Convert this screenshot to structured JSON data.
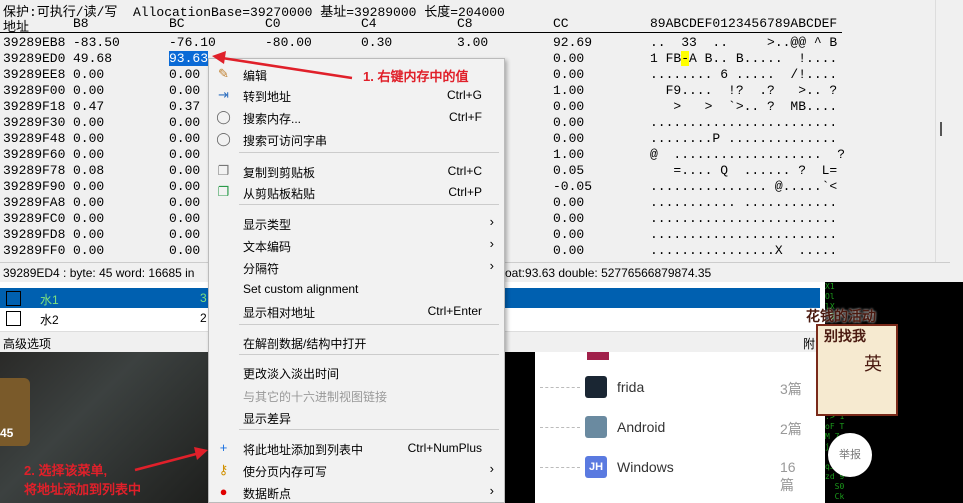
{
  "hexview": {
    "info": "保护:可执行/读/写  AllocationBase=39270000 基址=39289000 长度=204000",
    "headers": {
      "addr": "地址",
      "c1": "B8",
      "c2": "BC",
      "c3": "C0",
      "c4": "C4",
      "c5": "C8",
      "c6": "CC",
      "ascii": "89ABCDEF0123456789ABCDEF"
    },
    "rows": [
      {
        "addr": "39289EB8",
        "b8": "-83.50",
        "bc": "-76.10",
        "c0": "-80.00",
        "c4": "0.30",
        "c8": "3.00",
        "cc": "92.69",
        "ascii": "..  33  ..     >..@@ ^ B"
      },
      {
        "addr": "39289ED0",
        "b8": "49.68",
        "bc": "93.63",
        "c0": "",
        "c4": "",
        "c8": "",
        "cc": "0.00",
        "ascii_pre": "1 FB",
        "ascii_hl": "-",
        "ascii_post": "A B.. B.....  !...."
      },
      {
        "addr": "39289EE8",
        "b8": "0.00",
        "bc": "0.00",
        "cc": "0.00",
        "ascii": "........ 6 .....  /!...."
      },
      {
        "addr": "39289F00",
        "b8": "0.00",
        "bc": "0.00",
        "cc": "1.00",
        "ascii": "  F9....  !?  .?   >.. ?"
      },
      {
        "addr": "39289F18",
        "b8": "0.47",
        "bc": "0.37",
        "cc": "0.00",
        "ascii": "   >   >  `>.. ?  MB...."
      },
      {
        "addr": "39289F30",
        "b8": "0.00",
        "bc": "0.00",
        "cc": "0.00",
        "ascii": "........................"
      },
      {
        "addr": "39289F48",
        "b8": "0.00",
        "bc": "0.00",
        "cc": "0.00",
        "ascii": "........P .............."
      },
      {
        "addr": "39289F60",
        "b8": "0.00",
        "bc": "0.00",
        "cc": "1.00",
        "ascii": "@  ...................  ?"
      },
      {
        "addr": "39289F78",
        "b8": "0.08",
        "bc": "0.00",
        "cc": "0.05",
        "ascii": "   =.... Q  ...... ?  L="
      },
      {
        "addr": "39289F90",
        "b8": "0.00",
        "bc": "0.00",
        "cc": "-0.05",
        "ascii": "............... @.....`<"
      },
      {
        "addr": "39289FA8",
        "b8": "0.00",
        "bc": "0.00",
        "cc": "0.00",
        "ascii": "........... ............"
      },
      {
        "addr": "39289FC0",
        "b8": "0.00",
        "bc": "0.00",
        "cc": "0.00",
        "ascii": "........................"
      },
      {
        "addr": "39289FD8",
        "b8": "0.00",
        "bc": "0.00",
        "cc": "0.00",
        "ascii": "........................"
      },
      {
        "addr": "39289FF0",
        "b8": "0.00",
        "bc": "0.00",
        "cc": "0.00",
        "ascii": "................X  ....."
      }
    ]
  },
  "status": {
    "left": "39289ED4 : byte: 45 word: 16685 in",
    "right": "oat:93.63 double: 52776566879874.35"
  },
  "addrlist": {
    "rows": [
      {
        "name": "水1",
        "value": "3",
        "selected": true
      },
      {
        "name": "水2",
        "value": "2",
        "selected": false
      }
    ]
  },
  "adv": {
    "label": "高级选项",
    "right": "附"
  },
  "menu": {
    "items": [
      {
        "label": "编辑",
        "icon": "edit-icon"
      },
      {
        "label": "转到地址",
        "shortcut": "Ctrl+G",
        "icon": "goto-icon"
      },
      {
        "label": "搜索内存...",
        "shortcut": "Ctrl+F",
        "icon": "search-icon"
      },
      {
        "label": "搜索可访问字串",
        "icon": "search-icon"
      },
      {
        "label": "复制到剪贴板",
        "shortcut": "Ctrl+C",
        "icon": "copy-icon"
      },
      {
        "label": "从剪贴板粘贴",
        "shortcut": "Ctrl+P",
        "icon": "paste-icon"
      },
      {
        "label": "显示类型"
      },
      {
        "label": "文本编码"
      },
      {
        "label": "分隔符"
      },
      {
        "label": "Set custom alignment"
      },
      {
        "label": "显示相对地址",
        "shortcut": "Ctrl+Enter"
      },
      {
        "label": "在解剖数据/结构中打开"
      },
      {
        "label": "更改淡入淡出时间"
      },
      {
        "label": "与其它的十六进制视图链接",
        "disabled": true
      },
      {
        "label": "显示差异"
      },
      {
        "label": "将此地址添加到列表中",
        "shortcut": "Ctrl+NumPlus",
        "icon": "plus-icon"
      },
      {
        "label": "使分页内存可写",
        "icon": "key-icon"
      },
      {
        "label": "数据断点",
        "icon": "breakpoint-icon"
      }
    ]
  },
  "annotations": {
    "step1": "1. 右键内存中的值",
    "step2_line1": "2. 选择该菜单,",
    "step2_line2": "将地址添加到列表中",
    "color": "#e0202a"
  },
  "web": {
    "items": [
      {
        "name": "frida",
        "count": "3篇"
      },
      {
        "name": "Android",
        "count": "2篇"
      },
      {
        "name": "Windows",
        "count": "16篇"
      }
    ],
    "report": "举报",
    "sticker_line1": "花钱的活动",
    "sticker_line2": "别找我",
    "sticker_char": "英",
    "game_badge": "45"
  }
}
